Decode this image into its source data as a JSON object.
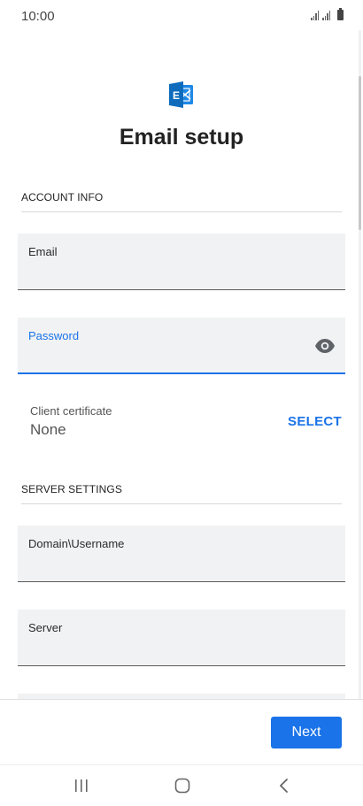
{
  "status_bar": {
    "time": "10:00"
  },
  "header": {
    "logo_icon": "exchange-logo-icon",
    "title": "Email setup"
  },
  "account_info": {
    "header": "ACCOUNT INFO",
    "email_label": "Email",
    "email_value": "",
    "password_label": "Password",
    "password_value": "",
    "client_certificate_label": "Client certificate",
    "client_certificate_value": "None",
    "select_label": "SELECT"
  },
  "server_settings": {
    "header": "SERVER SETTINGS",
    "domain_username_label": "Domain\\Username",
    "domain_username_value": "",
    "server_label": "Server",
    "server_value": ""
  },
  "footer": {
    "next_label": "Next"
  },
  "colors": {
    "accent": "#1a73e8",
    "field_bg": "#f1f2f4",
    "logo_blue": "#0f6cbd"
  },
  "nav_bar": {
    "recents_icon": "recents-icon",
    "home_icon": "home-icon",
    "back_icon": "back-icon"
  }
}
